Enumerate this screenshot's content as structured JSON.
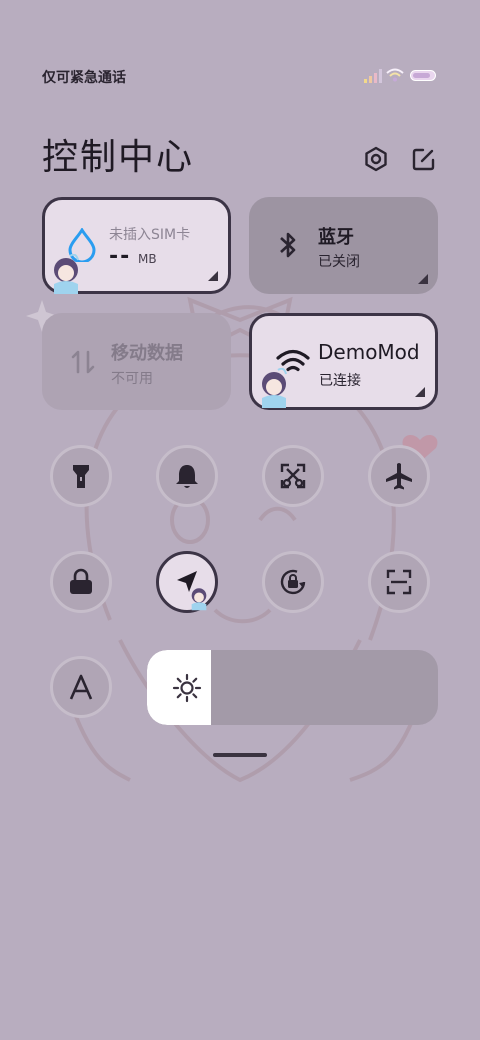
{
  "status_bar": {
    "carrier_text": "仅可紧急通话",
    "icons": [
      "signal-icon",
      "wifi-icon",
      "battery-icon"
    ]
  },
  "header": {
    "title": "控制中心",
    "icons": [
      "settings-icon",
      "edit-icon"
    ]
  },
  "tiles": {
    "data_usage": {
      "label": "未插入SIM卡",
      "value": "--",
      "unit": "MB",
      "icon": "water-drop-icon"
    },
    "bluetooth": {
      "label": "蓝牙",
      "status": "已关闭",
      "icon": "bluetooth-icon"
    },
    "mobile_data": {
      "label": "移动数据",
      "status": "不可用",
      "icon": "data-arrows-icon"
    },
    "wifi": {
      "label": "DemoMod",
      "status": "已连接",
      "icon": "wifi-icon"
    }
  },
  "toggles": [
    {
      "name": "flashlight",
      "icon": "flashlight-icon",
      "active": false
    },
    {
      "name": "mute",
      "icon": "bell-icon",
      "active": false
    },
    {
      "name": "screenshot",
      "icon": "scissors-icon",
      "active": false
    },
    {
      "name": "airplane-mode",
      "icon": "airplane-icon",
      "active": false
    },
    {
      "name": "lock-screen",
      "icon": "lock-icon",
      "active": false
    },
    {
      "name": "location",
      "icon": "location-arrow-icon",
      "active": true
    },
    {
      "name": "rotation-lock",
      "icon": "rotation-lock-icon",
      "active": false
    },
    {
      "name": "scanner",
      "icon": "scan-icon",
      "active": false
    },
    {
      "name": "font-size",
      "icon": "font-a-icon",
      "active": false
    }
  ],
  "brightness": {
    "level": 0.22,
    "icon": "sun-icon"
  },
  "colors": {
    "background": "#b8adbf",
    "tile_on": "#e7dde9",
    "tile_off": "#9d94a2",
    "accent_drop": "#2a9df0",
    "dark": "#3c3446"
  }
}
